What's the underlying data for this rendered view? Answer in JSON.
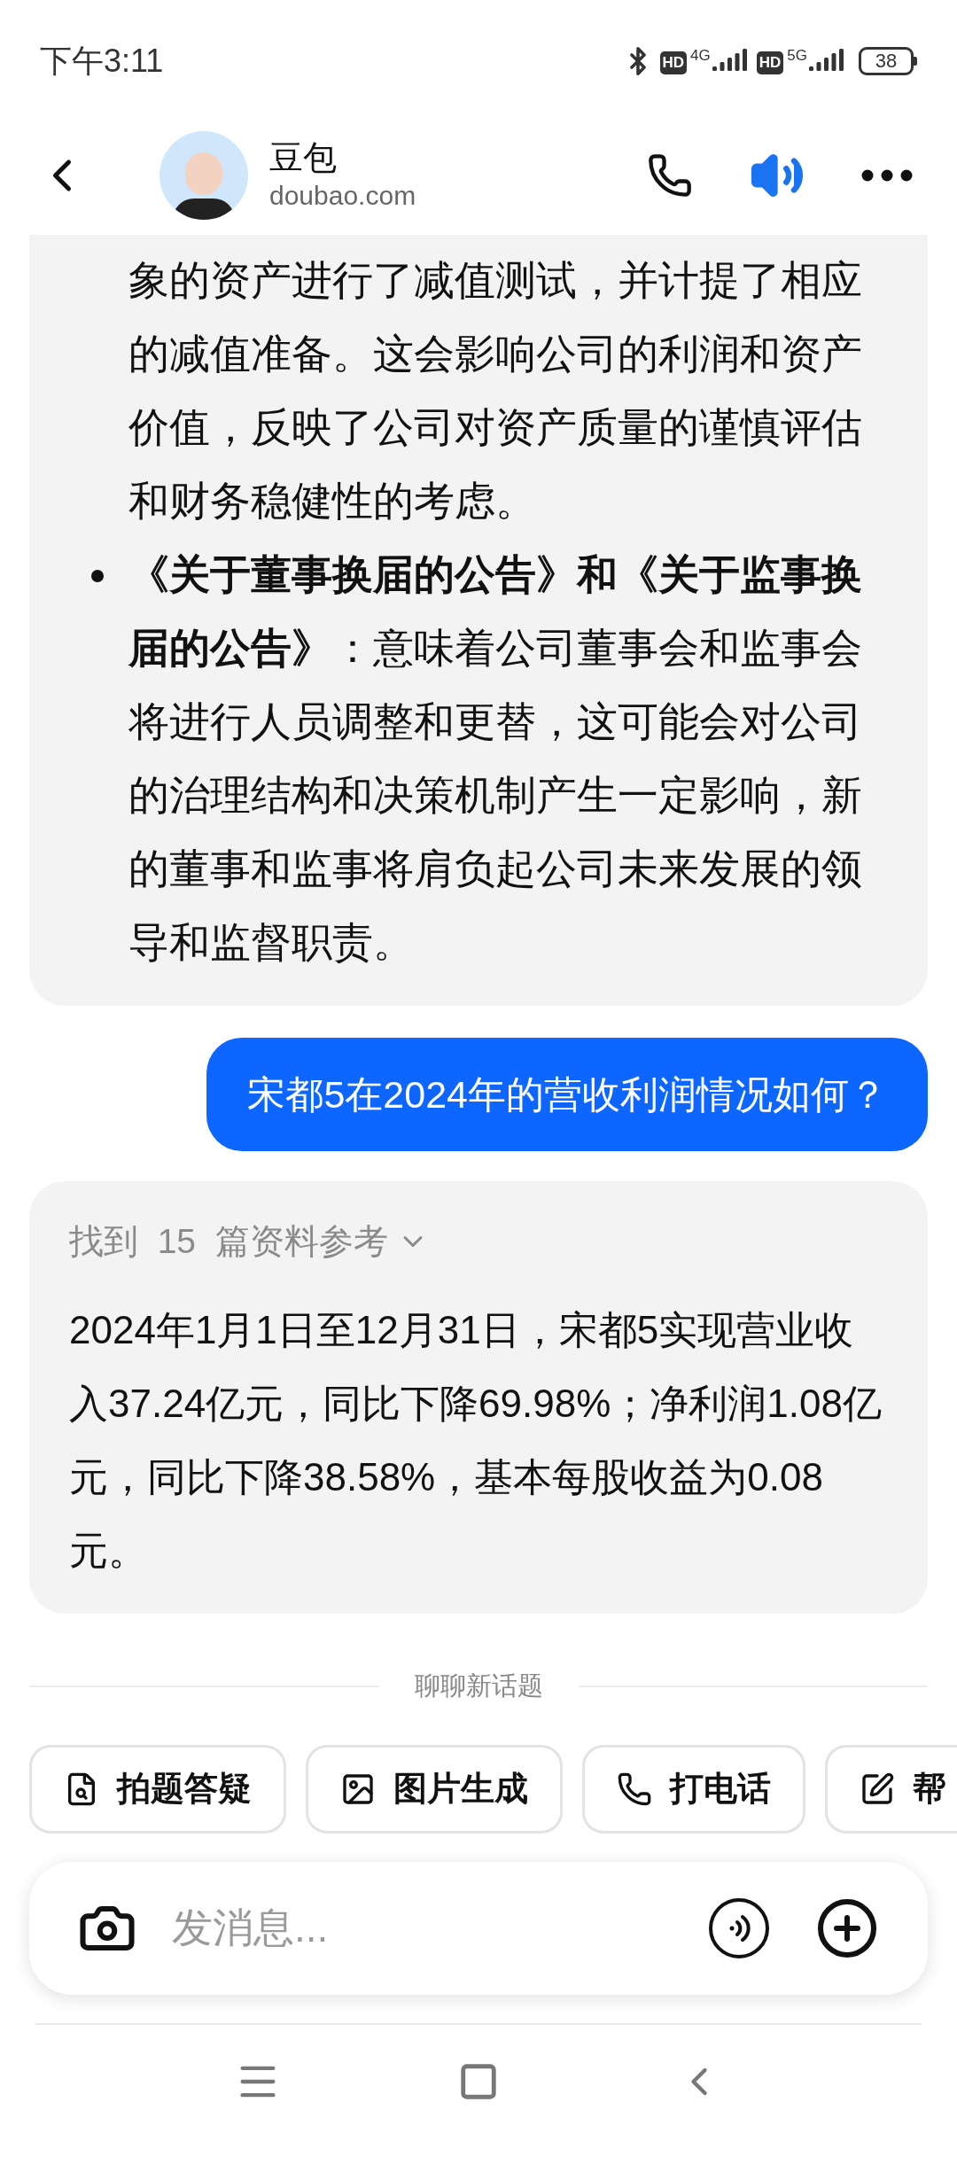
{
  "status_bar": {
    "time": "下午3:11",
    "sim1": {
      "hd": "HD",
      "network": "4G"
    },
    "sim2": {
      "hd": "HD",
      "network": "5G"
    },
    "battery": "38"
  },
  "header": {
    "name": "豆包",
    "domain": "doubao.com"
  },
  "messages": [
    {
      "kind": "bot_partial",
      "paragraphs": [
        {
          "bullet": false,
          "text": "象的资产进行了减值测试，并计提了相应的减值准备。这会影响公司的利润和资产价值，反映了公司对资产质量的谨慎评估和财务稳健性的考虑。"
        },
        {
          "bullet": true,
          "text": "**《关于董事换届的公告》和《关于监事换届的公告》**：意味着公司董事会和监事会将进行人员调整和更替，这可能会对公司的治理结构和决策机制产生一定影响，新的董事和监事将肩负起公司未来发展的领导和监督职责。"
        }
      ]
    },
    {
      "kind": "user",
      "text": "宋都5在2024年的营收利润情况如何？"
    },
    {
      "kind": "bot",
      "sources": "找到  15  篇资料参考",
      "text": "2024年1月1日至12月31日，宋都5实现营业收入37.24亿元，同比下降69.98%；净利润1.08亿元，同比下降38.58%，基本每股收益为0.08元。"
    }
  ],
  "divider": "聊聊新话题",
  "chips": [
    {
      "kind": "question",
      "label": "拍题答疑"
    },
    {
      "kind": "image",
      "label": "图片生成"
    },
    {
      "kind": "call",
      "label": "打电话"
    },
    {
      "kind": "write",
      "label": "帮"
    }
  ],
  "input": {
    "placeholder": "发消息..."
  }
}
